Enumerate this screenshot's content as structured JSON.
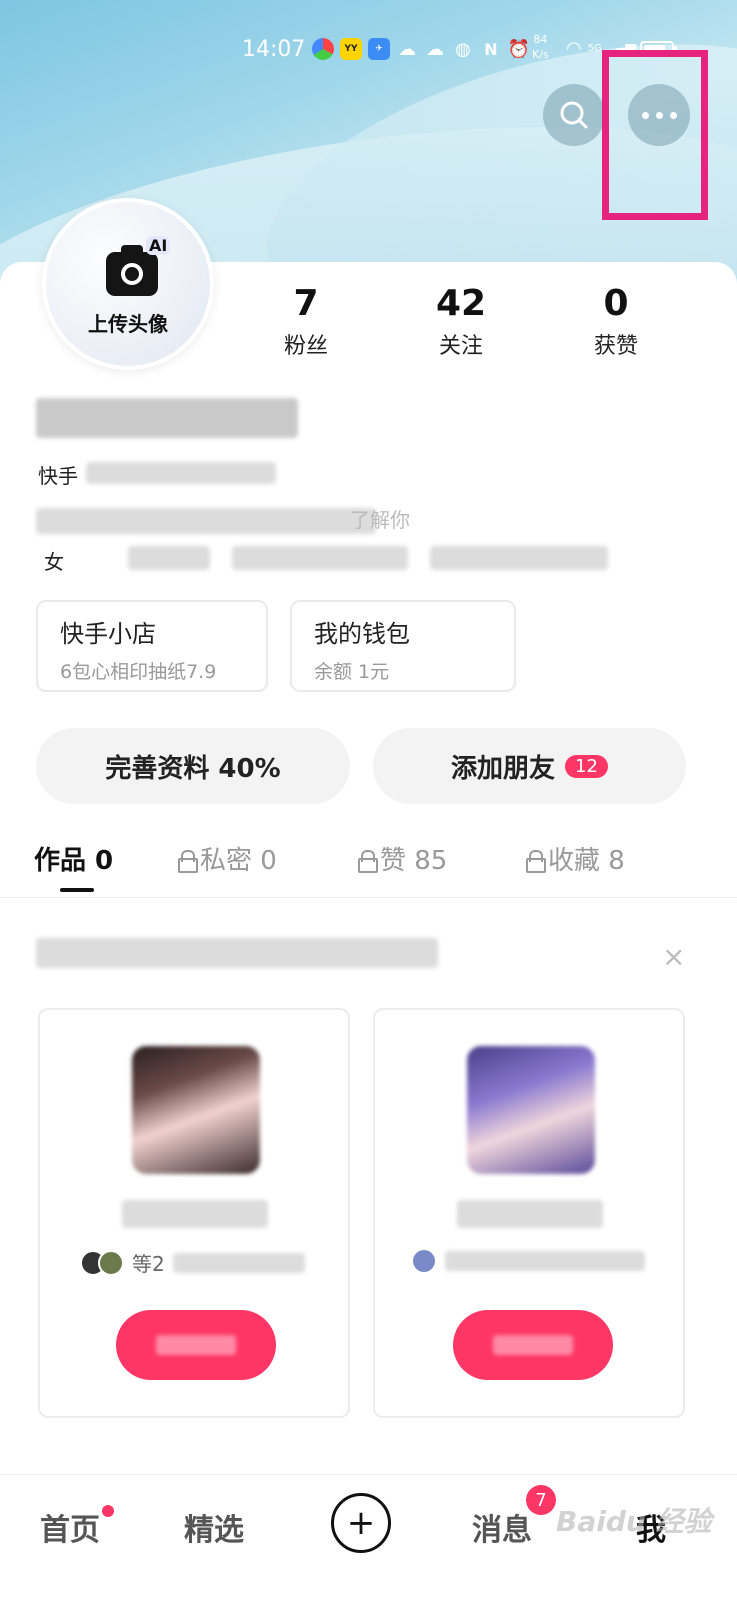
{
  "status_bar": {
    "time": "14:07",
    "net_speed_value": "84",
    "net_speed_unit": "K/s",
    "signal": "5G"
  },
  "profile": {
    "upload_label": "上传头像",
    "ai_badge": "AI",
    "stats": [
      {
        "value": "7",
        "label": "粉丝"
      },
      {
        "value": "42",
        "label": "关注"
      },
      {
        "value": "0",
        "label": "获赞"
      }
    ],
    "kuaishou_id_prefix": "快手",
    "bio_partial": "了解你",
    "gender_prefix": "女"
  },
  "services": [
    {
      "title": "快手小店",
      "subtitle": "6包心相印抽纸7.9"
    },
    {
      "title": "我的钱包",
      "subtitle": "余额 1元"
    }
  ],
  "actions": {
    "complete_profile": "完善资料 40%",
    "add_friends": "添加朋友",
    "add_friends_badge": "12"
  },
  "tabs": [
    {
      "label": "作品 0",
      "active": true
    },
    {
      "label": "私密 0"
    },
    {
      "label": "赞 85"
    },
    {
      "label": "收藏 8"
    }
  ],
  "recommend": {
    "close_glyph": "×",
    "cards": [
      {
        "meta_prefix": "等2"
      },
      {
        "meta_prefix": ""
      }
    ]
  },
  "bottom_nav": {
    "items": [
      "首页",
      "精选",
      "消息",
      "我"
    ],
    "plus_glyph": "+",
    "message_badge": "7"
  },
  "watermark": "Baidu 经验",
  "colors": {
    "accent": "#fe3666",
    "highlight": "#e6237e",
    "sky": "#9fd6ea"
  }
}
